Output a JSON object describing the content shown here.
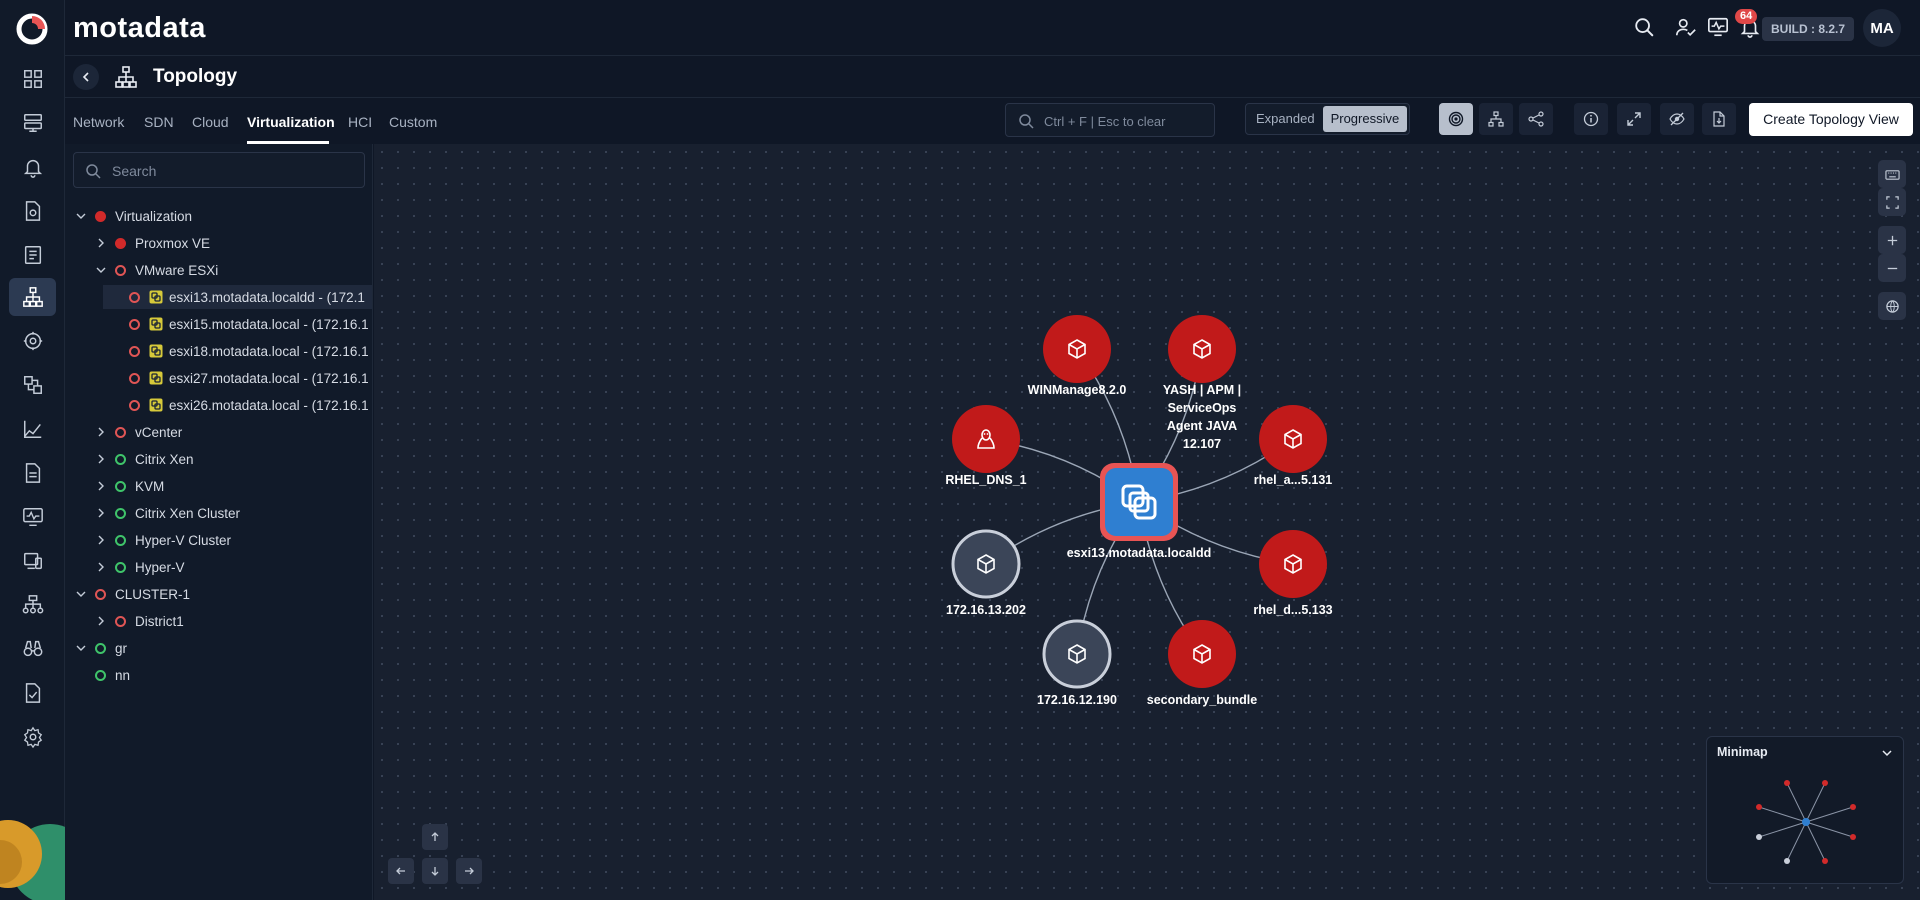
{
  "app": {
    "brand": "motadata",
    "build": "BUILD : 8.2.7",
    "notifications_count": "64",
    "user_initials": "MA"
  },
  "rail_icons": [
    "dashboard-icon",
    "monitor-icon",
    "alert-bell-icon",
    "log-icon",
    "metric-explorer-icon",
    "topology-icon",
    "apm-icon",
    "flow-icon",
    "trend-icon",
    "report-icon",
    "screen-icon",
    "device-icon",
    "hierarchy-icon",
    "binoculars-icon",
    "compliance-icon",
    "settings-icon"
  ],
  "page": {
    "title": "Topology"
  },
  "tabs": [
    "Network",
    "SDN",
    "Cloud",
    "Virtualization",
    "HCI",
    "Custom"
  ],
  "active_tab": "Virtualization",
  "toolbar": {
    "search_placeholder": "Ctrl + F | Esc to clear",
    "view_modes": [
      "Expanded",
      "Progressive"
    ],
    "active_view_mode": "Progressive",
    "create_label": "Create Topology View"
  },
  "tree": {
    "search_placeholder": "Search",
    "rows": [
      {
        "label": "Virtualization",
        "status": "fill-red",
        "expand": "down",
        "level": 0
      },
      {
        "label": "Proxmox VE",
        "status": "fill-red",
        "expand": "right",
        "level": 1
      },
      {
        "label": "VMware ESXi",
        "status": "ring-red",
        "expand": "down",
        "level": 1
      },
      {
        "label": "esxi13.motadata.localdd - (172.1",
        "status": "ring-red",
        "expand": "none",
        "level": 2,
        "icon": "vm",
        "selected": true
      },
      {
        "label": "esxi15.motadata.local - (172.16.1",
        "status": "ring-red",
        "expand": "none",
        "level": 2,
        "icon": "vm"
      },
      {
        "label": "esxi18.motadata.local - (172.16.1",
        "status": "ring-red",
        "expand": "none",
        "level": 2,
        "icon": "vm"
      },
      {
        "label": "esxi27.motadata.local - (172.16.1",
        "status": "ring-red",
        "expand": "none",
        "level": 2,
        "icon": "vm"
      },
      {
        "label": "esxi26.motadata.local - (172.16.1",
        "status": "ring-red",
        "expand": "none",
        "level": 2,
        "icon": "vm"
      },
      {
        "label": "vCenter",
        "status": "ring-red",
        "expand": "right",
        "level": 1
      },
      {
        "label": "Citrix Xen",
        "status": "ring-green",
        "expand": "right",
        "level": 1
      },
      {
        "label": "KVM",
        "status": "ring-green",
        "expand": "right",
        "level": 1
      },
      {
        "label": "Citrix Xen Cluster",
        "status": "ring-green",
        "expand": "right",
        "level": 1
      },
      {
        "label": "Hyper-V Cluster",
        "status": "ring-green",
        "expand": "right",
        "level": 1
      },
      {
        "label": "Hyper-V",
        "status": "ring-green",
        "expand": "right",
        "level": 1
      },
      {
        "label": "CLUSTER-1",
        "status": "ring-red",
        "expand": "down",
        "level": 0
      },
      {
        "label": "District1",
        "status": "ring-red",
        "expand": "right",
        "level": 1
      },
      {
        "label": "gr",
        "status": "ring-green",
        "expand": "down",
        "level": 0
      },
      {
        "label": "nn",
        "status": "ring-green",
        "expand": "none",
        "level": 1
      }
    ]
  },
  "topology": {
    "center": {
      "label": "esxi13.motadata.localdd",
      "icon": "vmware-icon"
    },
    "nodes": [
      {
        "label": [
          "WINManage8.2.0"
        ],
        "status": "down",
        "icon": "cube-icon"
      },
      {
        "label": [
          "YASH | APM |",
          "ServiceOps",
          "Agent JAVA",
          "12.107"
        ],
        "status": "down",
        "icon": "cube-icon"
      },
      {
        "label": [
          "RHEL_DNS_1"
        ],
        "status": "down",
        "icon": "linux-icon"
      },
      {
        "label": [
          "rhel_a...5.131"
        ],
        "status": "down",
        "icon": "cube-icon"
      },
      {
        "label": [
          "172.16.13.202"
        ],
        "status": "unknown",
        "icon": "cube-icon"
      },
      {
        "label": [
          "rhel_d...5.133"
        ],
        "status": "down",
        "icon": "cube-icon"
      },
      {
        "label": [
          "172.16.12.190"
        ],
        "status": "unknown",
        "icon": "cube-icon"
      },
      {
        "label": [
          "secondary_bundle"
        ],
        "status": "down",
        "icon": "cube-icon"
      }
    ]
  },
  "minimap": {
    "title": "Minimap"
  },
  "colors": {
    "down": "#c11a1a",
    "unknown": "#3b4558",
    "center": "#2f7fd1",
    "center_ring": "#e85454",
    "edge": "#9ba6b6"
  }
}
